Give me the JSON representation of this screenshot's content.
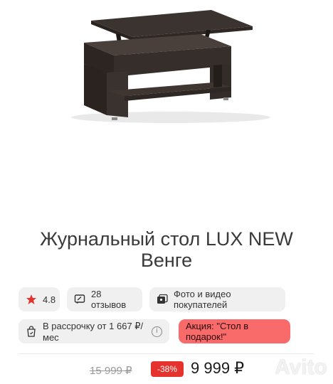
{
  "product": {
    "title_line1": "Журнальный стол LUX NEW",
    "title_line2": "Венге"
  },
  "chips": {
    "rating": "4.8",
    "reviews": "28 отзывов",
    "media": "Фото и видео покупателей",
    "installment": "В рассрочку от 1 667 ₽/мес",
    "installment_info": "i",
    "promo": "Акция: \"Стол в подарок!\""
  },
  "price": {
    "old": "15 999 ₽",
    "discount": "-38%",
    "current": "9 999 ₽"
  },
  "watermark": "Avito",
  "colors": {
    "star": "#e5322d",
    "promo_bg": "#f96b6b",
    "discount_bg": "#e5322d",
    "chip_bg": "#f0f0f0",
    "table": "#3b3330"
  },
  "icons": {
    "rating": "star-icon",
    "reviews": "review-icon",
    "media": "photo-gallery-icon",
    "installment": "bag-installment-icon",
    "info": "info-icon"
  }
}
